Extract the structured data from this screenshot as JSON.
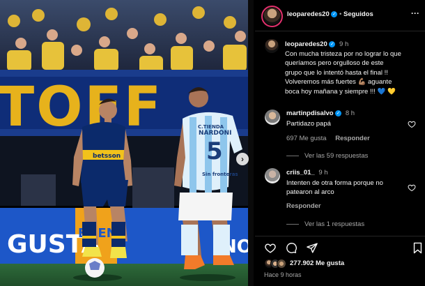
{
  "photo": {
    "banner_text": "TOFF",
    "board_left": "GUSTA",
    "board_mid": "BUEN",
    "board_right": "NOS",
    "player_left_sponsor": "betsson",
    "player_right_name": "NARDONI",
    "player_right_number": "5",
    "player_right_sponsor": "Sin fronteras",
    "player_right_top_text": "C.TIENDA",
    "next_glyph": "›"
  },
  "header": {
    "username": "leoparedes20",
    "verified_glyph": "✓",
    "separator": "•",
    "follow_status": "Seguidos",
    "more_glyph": "···"
  },
  "caption": {
    "username": "leoparedes20",
    "time": "9 h",
    "lines": [
      "Con mucha tristeza por no lograr lo que",
      "queríamos pero orgulloso de este",
      "grupo que lo intentó hasta el final !!",
      "Volveremos más fuertes 💪🏽 aguante",
      "boca hoy mañana y siempre !!!"
    ],
    "emojis": "💙 💛"
  },
  "comments": [
    {
      "username": "martinpdisalvo",
      "time": "8 h",
      "text": "Partidazo papá",
      "likes": "697 Me gusta",
      "reply": "Responder",
      "view_replies": "Ver las 59 respuestas"
    },
    {
      "username": "criis_01_",
      "time": "9 h",
      "text_lines": [
        "Intenten de otra forma porque no",
        "patearon al arco"
      ],
      "reply": "Responder",
      "view_replies": "Ver las 1 respuestas"
    }
  ],
  "footer": {
    "likes": "277.902 Me gusta",
    "timestamp": "Hace 9 horas"
  },
  "colors": {
    "accent_blue": "#0095f6",
    "boca_blue": "#0b2a6b",
    "boca_yellow": "#f2c21b",
    "racing_light_blue": "#8ec6ec"
  }
}
